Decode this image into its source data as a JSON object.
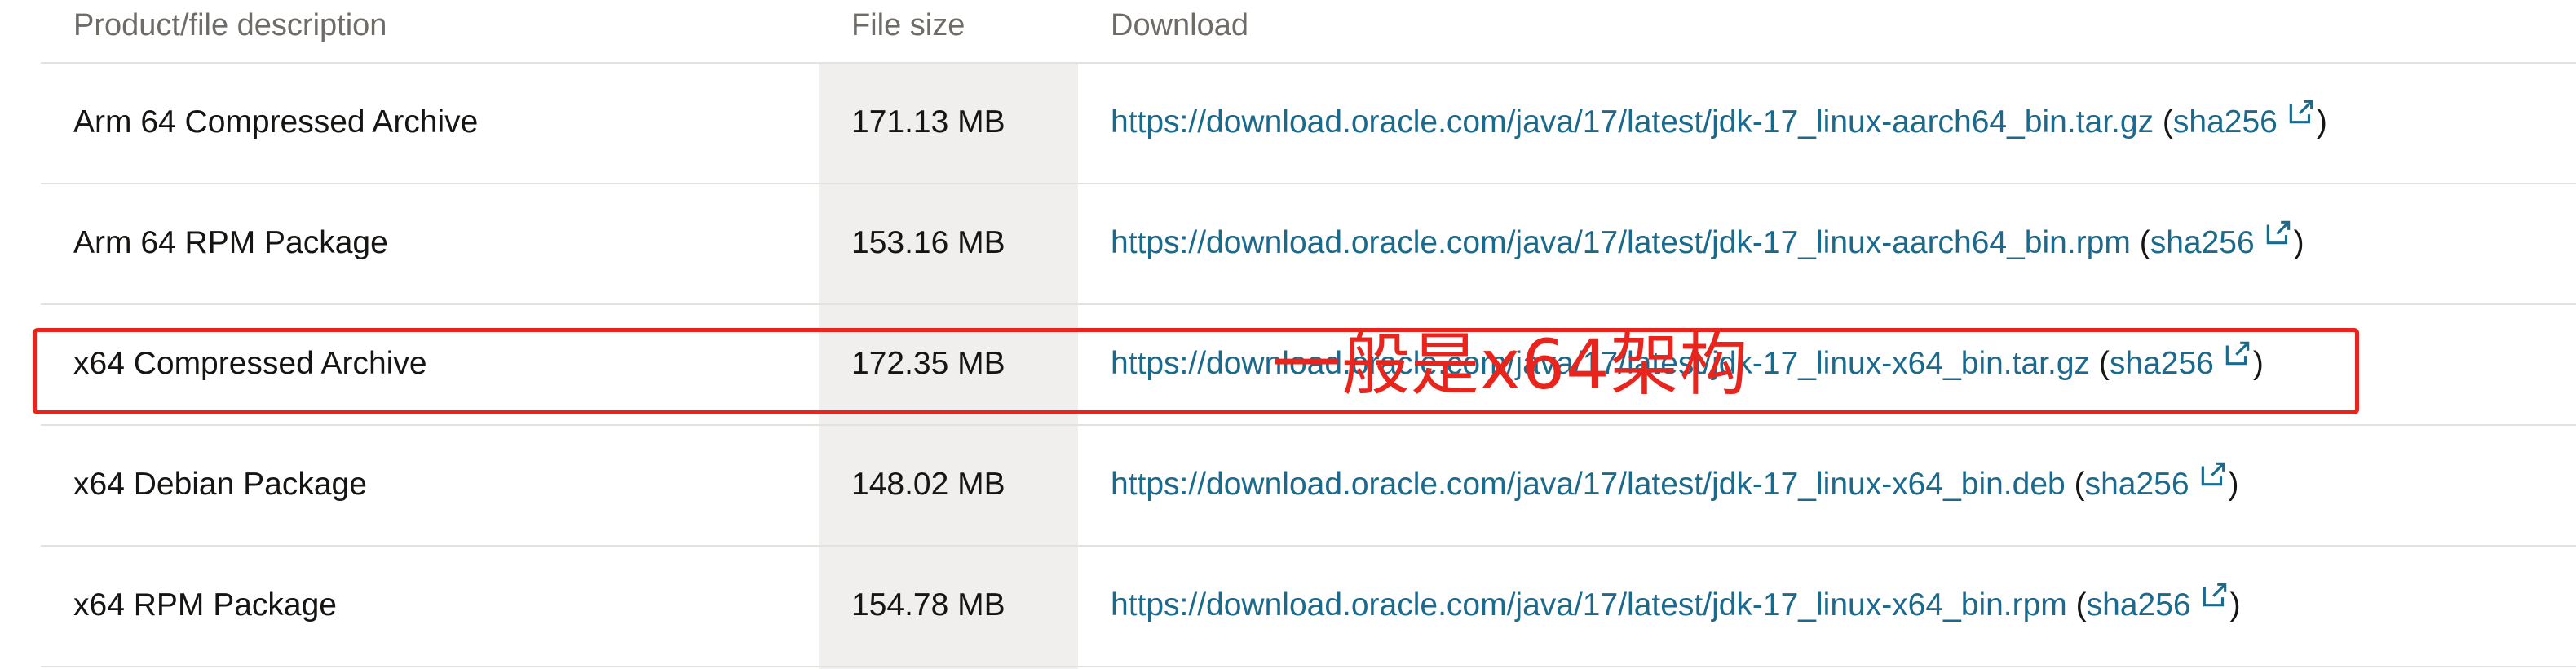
{
  "table": {
    "headers": {
      "description": "Product/file description",
      "size": "File size",
      "download": "Download"
    },
    "rows": [
      {
        "description": "Arm 64 Compressed Archive",
        "size": "171.13 MB",
        "url": "https://download.oracle.com/java/17/latest/jdk-17_linux-aarch64_bin.tar.gz",
        "open_paren": "(",
        "checksum": "sha256",
        "close_paren": ")"
      },
      {
        "description": "Arm 64 RPM Package",
        "size": "153.16 MB",
        "url": "https://download.oracle.com/java/17/latest/jdk-17_linux-aarch64_bin.rpm",
        "open_paren": "(",
        "checksum": "sha256",
        "close_paren": ")"
      },
      {
        "description": "x64 Compressed Archive",
        "size": "172.35 MB",
        "url": "https://download.oracle.com/java/17/latest/jdk-17_linux-x64_bin.tar.gz",
        "open_paren": "(",
        "checksum": "sha256",
        "close_paren": ")"
      },
      {
        "description": "x64 Debian Package",
        "size": "148.02 MB",
        "url": "https://download.oracle.com/java/17/latest/jdk-17_linux-x64_bin.deb",
        "open_paren": "(",
        "checksum": "sha256",
        "close_paren": ")"
      },
      {
        "description": "x64 RPM Package",
        "size": "154.78 MB",
        "url": "https://download.oracle.com/java/17/latest/jdk-17_linux-x64_bin.rpm",
        "open_paren": "(",
        "checksum": "sha256",
        "close_paren": ")"
      }
    ]
  },
  "annotation": {
    "text": "一般是x64架构",
    "color": "#e8241c"
  },
  "colors": {
    "link": "#1a6a8e",
    "size_column_bg": "#f1efed",
    "divider": "#e4e2df"
  },
  "icons": {
    "external_link": "external-link-icon"
  }
}
